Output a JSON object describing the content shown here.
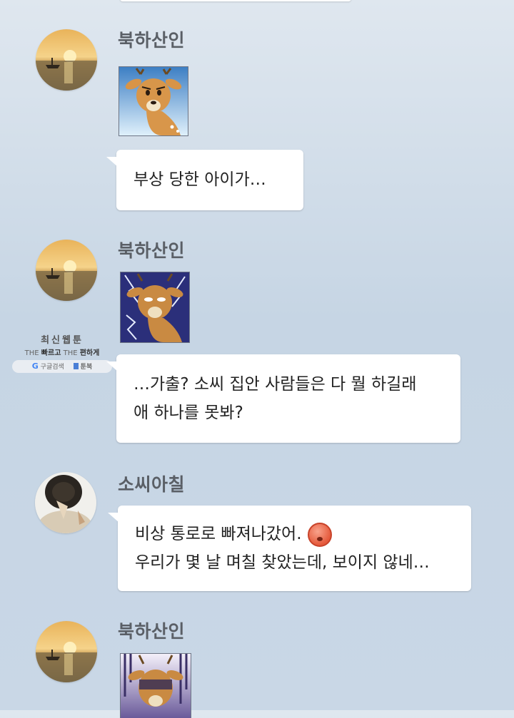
{
  "colors": {
    "background_top": "#dfe7ef",
    "background_bottom": "#c9d7e6",
    "bubble": "#ffffff",
    "name_text": "#5a5f66"
  },
  "watermark": {
    "title": "최신웹툰",
    "tag_the1": "THE",
    "tag_fast": "빠르고",
    "tag_the2": "THE",
    "tag_easy": "편하게",
    "search_label": "구글검색",
    "site_label": "툰북"
  },
  "messages": [
    {
      "sender": "북하산인",
      "avatar": "sunset-boat-avatar",
      "sticker": "worried-deer-sticker",
      "lines": [
        "부상 당한 아이가…"
      ]
    },
    {
      "sender": "북하산인",
      "avatar": "sunset-boat-avatar",
      "sticker": "shocked-deer-lightning-sticker",
      "lines": [
        "…가출? 소씨 집안 사람들은 다 뭘 하길래",
        "애 하나를 못봐?"
      ]
    },
    {
      "sender": "소씨아칠",
      "avatar": "hat-person-avatar",
      "lines": [
        "비상 통로로 빠져나갔어.",
        "우리가 몇 날 며칠 찾았는데, 보이지 않네…"
      ],
      "emoji": "anxious-sweat-emoji"
    },
    {
      "sender": "북하산인",
      "avatar": "sunset-boat-avatar",
      "sticker": "gloomy-deer-sticker"
    }
  ]
}
